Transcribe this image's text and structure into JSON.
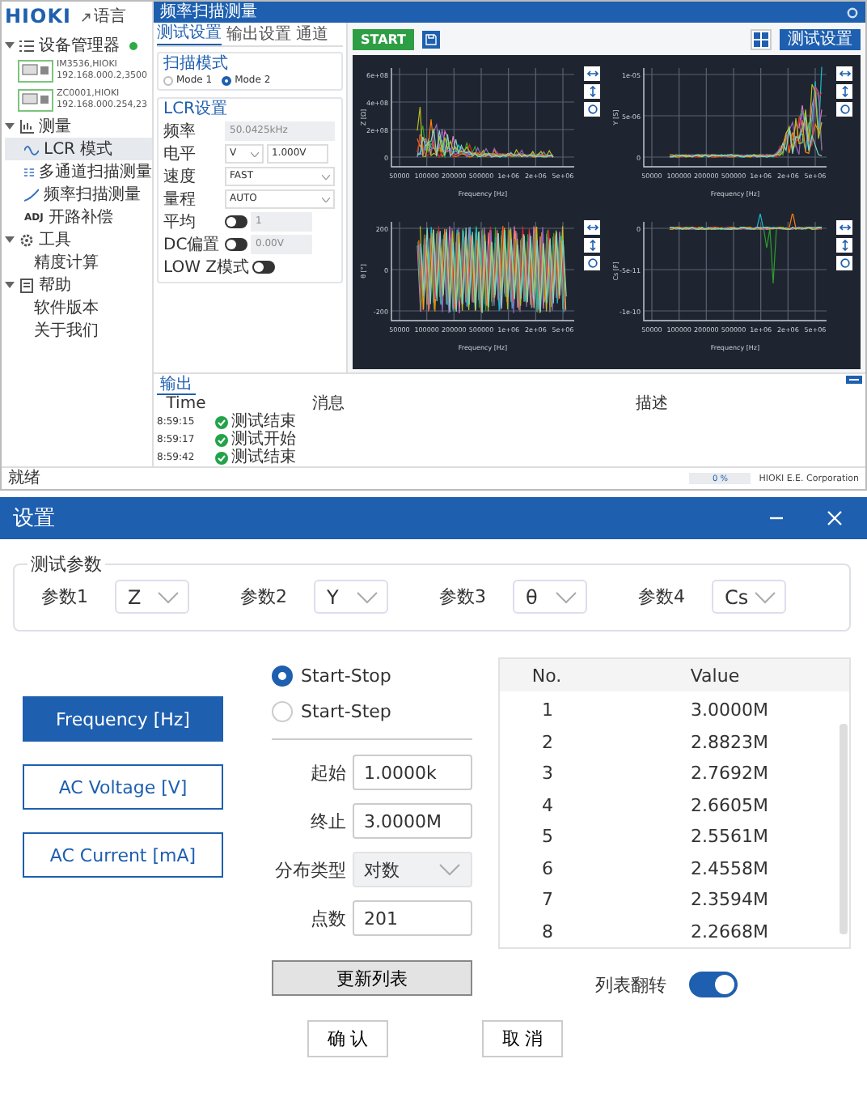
{
  "app": {
    "logo": "HIOKI",
    "language_button": "语言",
    "title": "频率扫描测量",
    "sidebar": [
      {
        "label": "设备管理器",
        "kind": "devices",
        "expanded": true,
        "connected": true,
        "devices": [
          {
            "model": "IM3536,HIOKI",
            "address": "192.168.000.2,3500"
          },
          {
            "model": "ZC0001,HIOKI",
            "address": "192.168.000.254,23"
          }
        ]
      },
      {
        "label": "测量",
        "kind": "measure",
        "expanded": true,
        "items": [
          {
            "label": "LCR 模式",
            "kind": "lcr",
            "selected": true
          },
          {
            "label": "多通道扫描测量",
            "kind": "multi",
            "selected": false
          },
          {
            "label": "频率扫描测量",
            "kind": "sweep",
            "selected": false
          },
          {
            "label": "开路补偿",
            "kind": "adj",
            "badge": "ADJ",
            "selected": false
          }
        ]
      },
      {
        "label": "工具",
        "kind": "tools",
        "expanded": true,
        "items": [
          {
            "label": "精度计算",
            "kind": "plain",
            "selected": false
          }
        ]
      },
      {
        "label": "帮助",
        "kind": "help",
        "expanded": true,
        "items": [
          {
            "label": "软件版本",
            "kind": "plain",
            "selected": false
          },
          {
            "label": "关于我们",
            "kind": "plain",
            "selected": false
          }
        ]
      }
    ],
    "tabs": [
      {
        "label": "测试设置",
        "selected": true
      },
      {
        "label": "输出设置",
        "selected": false
      },
      {
        "label": "通道",
        "selected": false
      }
    ],
    "scan_mode": {
      "title": "扫描模式",
      "options": [
        {
          "label": "Mode 1",
          "selected": false
        },
        {
          "label": "Mode 2",
          "selected": true
        }
      ]
    },
    "lcr": {
      "title": "LCR设置",
      "rows": [
        {
          "label": "频率",
          "kind": "input",
          "value": "50.0425kHz",
          "disabled": true
        },
        {
          "label": "电平",
          "kind": "select-input",
          "option": "V",
          "value": "1.000V",
          "disabled": false
        },
        {
          "label": "速度",
          "kind": "select",
          "value": "FAST",
          "disabled": false
        },
        {
          "label": "量程",
          "kind": "select",
          "value": "AUTO",
          "disabled": false
        },
        {
          "label": "平均",
          "kind": "toggle-input",
          "on": false,
          "value": "1",
          "disabled": true
        },
        {
          "label": "DC偏置",
          "kind": "toggle-input",
          "on": false,
          "value": "0.00V",
          "disabled": true
        },
        {
          "label": "LOW Z模式",
          "kind": "toggle",
          "on": false
        }
      ]
    },
    "start_button": "START",
    "settings_button": "测试设置",
    "plots": [
      {
        "kind": "decay",
        "ylabel": "Z [Ω]",
        "yticks": [
          "6e+08",
          "4e+08",
          "2e+08",
          "0"
        ],
        "xticks": [
          "50000",
          "100000",
          "200000",
          "500000",
          "1e+06",
          "2e+06",
          "5e+06"
        ],
        "xlabel": "Frequency [Hz]"
      },
      {
        "kind": "rise",
        "ylabel": "Y [S]",
        "yticks": [
          "1e-05",
          "5e-06",
          "0"
        ],
        "xticks": [
          "50000",
          "100000",
          "200000",
          "500000",
          "1e+06",
          "2e+06",
          "5e+06"
        ],
        "xlabel": "Frequency [Hz]"
      },
      {
        "kind": "band",
        "ylabel": "θ [°]",
        "yticks": [
          "200",
          "0",
          "-200"
        ],
        "xticks": [
          "50000",
          "100000",
          "200000",
          "500000",
          "1e+06",
          "2e+06",
          "5e+06"
        ],
        "xlabel": "Frequency [Hz]"
      },
      {
        "kind": "flat",
        "ylabel": "Cs [F]",
        "yticks": [
          "0",
          "-5e-11",
          "-1e-10"
        ],
        "xticks": [
          "50000",
          "100000",
          "200000",
          "500000",
          "1e+06",
          "2e+06",
          "5e+06"
        ],
        "xlabel": "Frequency [Hz]"
      }
    ],
    "output": {
      "tab": "输出",
      "columns": [
        "Time",
        "消息",
        "描述"
      ],
      "rows": [
        {
          "time": "8:59:15",
          "message": "测试结束"
        },
        {
          "time": "8:59:17",
          "message": "测试开始"
        },
        {
          "time": "8:59:42",
          "message": "测试结束"
        }
      ]
    },
    "status_bar": {
      "text": "就绪",
      "progress": {
        "level": 0,
        "label": "0 %"
      },
      "company": "HIOKI E.E. Corporation"
    }
  },
  "dialog": {
    "title": "设置",
    "params_group": "测试参数",
    "params": [
      {
        "label": "参数1",
        "value": "Z"
      },
      {
        "label": "参数2",
        "value": "Y"
      },
      {
        "label": "参数3",
        "value": "θ"
      },
      {
        "label": "参数4",
        "value": "Cs"
      }
    ],
    "sweep_buttons": [
      {
        "label": "Frequency [Hz]",
        "selected": true
      },
      {
        "label": "AC Voltage [V]",
        "selected": false
      },
      {
        "label": "AC Current [mA]",
        "selected": false
      }
    ],
    "modes": [
      {
        "label": "Start-Stop",
        "selected": true
      },
      {
        "label": "Start-Step",
        "selected": false
      }
    ],
    "fields": [
      {
        "label": "起始",
        "kind": "input",
        "value": "1.0000k"
      },
      {
        "label": "终止",
        "kind": "input",
        "value": "3.0000M"
      },
      {
        "label": "分布类型",
        "kind": "select",
        "value": "对数"
      },
      {
        "label": "点数",
        "kind": "input",
        "value": "201"
      }
    ],
    "table": {
      "columns": [
        "No.",
        "Value"
      ],
      "rows": [
        [
          "1",
          "3.0000M"
        ],
        [
          "2",
          "2.8823M"
        ],
        [
          "3",
          "2.7692M"
        ],
        [
          "4",
          "2.6605M"
        ],
        [
          "5",
          "2.5561M"
        ],
        [
          "6",
          "2.4558M"
        ],
        [
          "7",
          "2.3594M"
        ],
        [
          "8",
          "2.2668M"
        ]
      ]
    },
    "update_button": "更新列表",
    "reverse": {
      "label": "列表翻转",
      "on": true
    },
    "buttons": [
      "确 认",
      "取 消"
    ]
  }
}
